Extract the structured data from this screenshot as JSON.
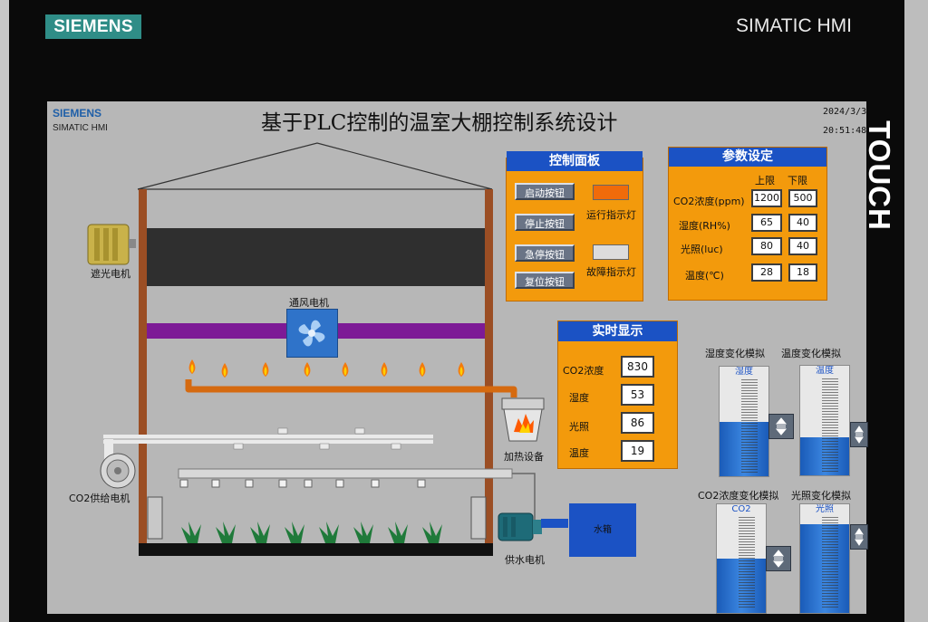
{
  "brand": {
    "logo": "SIEMENS",
    "hmi": "SIMATIC HMI",
    "touch": "TOUCH"
  },
  "screen": {
    "brand": {
      "logo": "SIEMENS",
      "sub": "SIMATIC HMI"
    },
    "title": "基于PLC控制的温室大棚控制系统设计",
    "date": "2024/3/3",
    "time": "20:51:48"
  },
  "equipment": {
    "shade_motor": "遮光电机",
    "fan_motor": "通风电机",
    "heater": "加热设备",
    "co2_motor": "CO2供给电机",
    "water_motor": "供水电机",
    "water_tank": "水箱"
  },
  "control_panel": {
    "title": "控制面板",
    "start": "启动按钮",
    "stop": "停止按钮",
    "estop": "急停按钮",
    "reset": "复位按钮",
    "run_light": "运行指示灯",
    "fault_light": "故障指示灯",
    "run_light_color": "#f06b0a",
    "fault_light_color": "#dcdcdc"
  },
  "params": {
    "title": "参数设定",
    "upper": "上限",
    "lower": "下限",
    "rows": [
      {
        "label": "CO2浓度(ppm)",
        "upper": "1200",
        "lower": "500"
      },
      {
        "label": "湿度(RH%)",
        "upper": "65",
        "lower": "40"
      },
      {
        "label": "光照(luc)",
        "upper": "80",
        "lower": "40"
      },
      {
        "label": "温度(℃)",
        "upper": "28",
        "lower": "18"
      }
    ]
  },
  "realtime": {
    "title": "实时显示",
    "rows": [
      {
        "label": "CO2浓度",
        "value": "830"
      },
      {
        "label": "湿度",
        "value": "53"
      },
      {
        "label": "光照",
        "value": "86"
      },
      {
        "label": "温度",
        "value": "19"
      }
    ]
  },
  "sims": {
    "humidity": {
      "caption": "湿度变化模拟",
      "tank_label": "湿度",
      "level": 0.5
    },
    "temperature": {
      "caption": "温度变化模拟",
      "tank_label": "温度",
      "level": 0.35
    },
    "co2": {
      "caption": "CO2浓度变化模拟",
      "tank_label": "CO2",
      "level": 0.5
    },
    "light": {
      "caption": "光照变化模拟",
      "tank_label": "光照",
      "level": 0.82
    }
  },
  "colors": {
    "panel": "#f39a0c",
    "header": "#1b52c4",
    "tank_fill": "#2a6fd0",
    "pipe_orange": "#d56a10",
    "purple_bar": "#7d1a96"
  }
}
